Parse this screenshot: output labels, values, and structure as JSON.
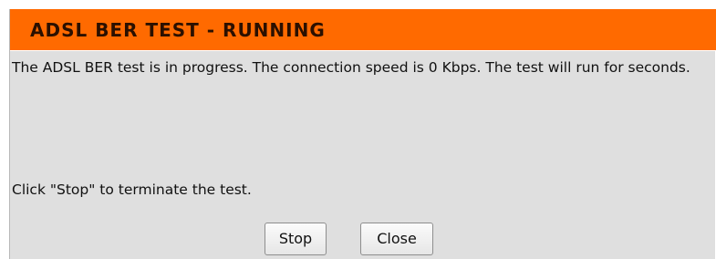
{
  "header": {
    "title": "ADSL BER TEST - RUNNING"
  },
  "body": {
    "message": "The ADSL BER test is in progress. The connection speed is 0 Kbps. The test will run for seconds.",
    "instruction": "Click \"Stop\" to terminate the test."
  },
  "buttons": {
    "stop_label": "Stop",
    "close_label": "Close"
  },
  "colors": {
    "header_background": "#ff6a00",
    "panel_background": "#dfdfdf"
  }
}
